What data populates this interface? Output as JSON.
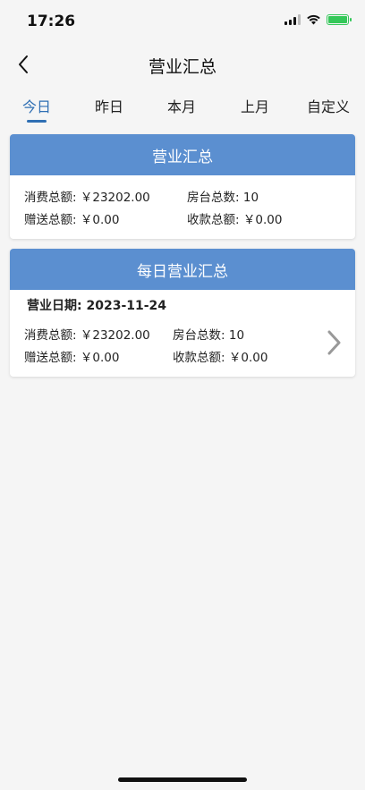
{
  "status_bar": {
    "time": "17:26"
  },
  "nav": {
    "title": "营业汇总"
  },
  "tabs": [
    {
      "label": "今日",
      "active": true
    },
    {
      "label": "昨日",
      "active": false
    },
    {
      "label": "本月",
      "active": false
    },
    {
      "label": "上月",
      "active": false
    },
    {
      "label": "自定义",
      "active": false
    }
  ],
  "summary_card": {
    "title": "营业汇总",
    "consumption_label": "消费总额:",
    "consumption_value": "￥23202.00",
    "tables_label": "房台总数:",
    "tables_value": "10",
    "gift_label": "赠送总额:",
    "gift_value": "￥0.00",
    "collection_label": "收款总额:",
    "collection_value": "￥0.00"
  },
  "daily_card": {
    "title": "每日营业汇总",
    "date_label": "营业日期:",
    "date_value": "2023-11-24",
    "consumption_label": "消费总额:",
    "consumption_value": "￥23202.00",
    "tables_label": "房台总数:",
    "tables_value": "10",
    "gift_label": "赠送总额:",
    "gift_value": "￥0.00",
    "collection_label": "收款总额:",
    "collection_value": "￥0.00"
  },
  "colors": {
    "accent": "#2f6fb4",
    "card_header": "#5b8fd0",
    "battery": "#34c759"
  }
}
